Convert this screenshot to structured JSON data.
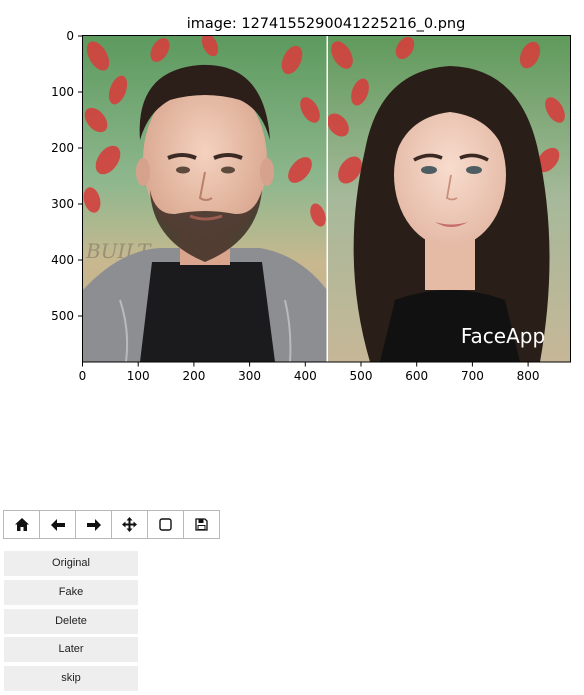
{
  "plot": {
    "title": "image: 1274155290041225216_0.png",
    "watermark": "FaceApp",
    "yticks": [
      "0",
      "100",
      "200",
      "300",
      "400",
      "500"
    ],
    "xticks": [
      "0",
      "100",
      "200",
      "300",
      "400",
      "500",
      "600",
      "700",
      "800"
    ]
  },
  "toolbar": {
    "items": [
      {
        "icon": "home-icon"
      },
      {
        "icon": "back-arrow-icon"
      },
      {
        "icon": "forward-arrow-icon"
      },
      {
        "icon": "pan-move-icon"
      },
      {
        "icon": "zoom-rect-icon"
      },
      {
        "icon": "save-figure-icon"
      }
    ]
  },
  "actions": {
    "original": "Original",
    "fake": "Fake",
    "delete": "Delete",
    "later": "Later",
    "skip": "skip"
  }
}
